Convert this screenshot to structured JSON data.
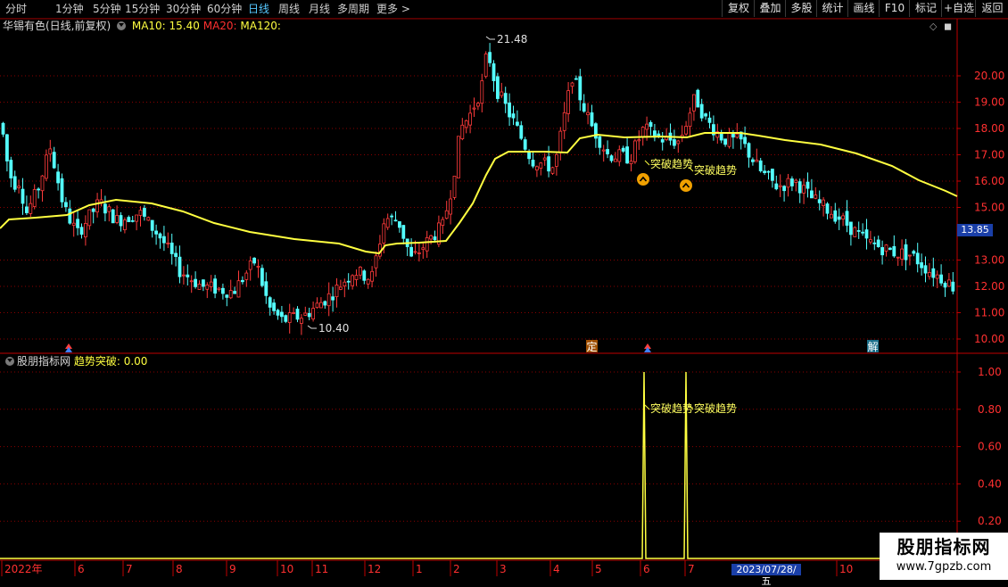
{
  "toolbar": {
    "periods": [
      {
        "label": "分时",
        "active": false
      },
      {
        "label": "1分钟",
        "active": false
      },
      {
        "label": "5分钟",
        "active": false
      },
      {
        "label": "15分钟",
        "active": false
      },
      {
        "label": "30分钟",
        "active": false
      },
      {
        "label": "60分钟",
        "active": false
      },
      {
        "label": "日线",
        "active": true
      },
      {
        "label": "周线",
        "active": false
      },
      {
        "label": "月线",
        "active": false
      },
      {
        "label": "多周期",
        "active": false
      },
      {
        "label": "更多 >",
        "active": false
      }
    ],
    "right_buttons": [
      "复权",
      "叠加",
      "多股",
      "统计",
      "画线",
      "F10",
      "标记",
      "+自选",
      "返回"
    ]
  },
  "main_chart": {
    "stock_label": "华锡有色(日线,前复权)",
    "ma10_label": "MA10: 15.40",
    "ma20_label": "MA20:",
    "ma120_label": "MA120:",
    "high_label": "21.48",
    "low_label": "10.40",
    "current_price_tag": "13.85",
    "price_axis": [
      "20.00",
      "19.00",
      "18.00",
      "17.00",
      "16.00",
      "15.00",
      "13.00",
      "12.00",
      "11.00",
      "10.00"
    ],
    "signal_labels": [
      "突破趋势",
      "突破趋势"
    ],
    "markers": [
      "定",
      "解"
    ]
  },
  "sub_chart": {
    "indicator_name": "股朋指标网",
    "value_label": "趋势突破: 0.00",
    "signal_labels": [
      "突破趋势",
      "突破趋势"
    ],
    "axis": [
      "1.00",
      "0.80",
      "0.60",
      "0.40",
      "0.20"
    ]
  },
  "time_axis": {
    "labels": [
      "2022年",
      "6",
      "7",
      "8",
      "9",
      "10",
      "11",
      "12",
      "1",
      "2",
      "3",
      "4",
      "5",
      "6",
      "7",
      "8",
      "10"
    ],
    "cursor_date": "2023/07/28/五"
  },
  "watermark": {
    "title": "股朋指标网",
    "url": "www.7gpzb.com"
  },
  "colors": {
    "background": "#000000",
    "up_candle": "#ff3b3b",
    "down_candle": "#54ffff",
    "ma_line": "#ffff40",
    "grid": "#8a0000",
    "axis_text": "#ff3030"
  }
}
